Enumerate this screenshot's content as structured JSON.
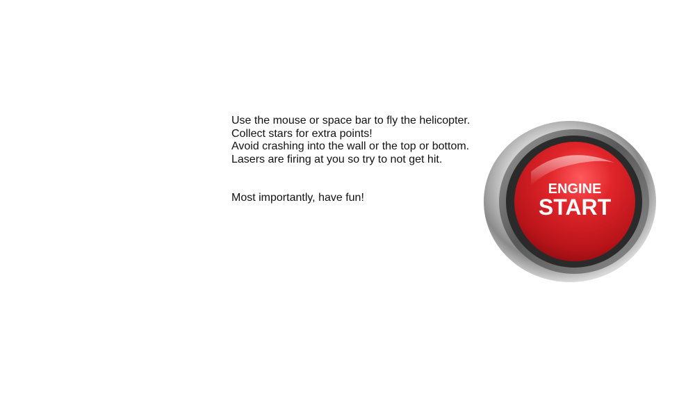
{
  "instructions": {
    "lines": [
      "Use the mouse or space bar to fly the helicopter.",
      "Collect stars for extra points!",
      "Avoid crashing into the wall or the top or bottom.",
      "Lasers are firing at you so try to not get hit."
    ],
    "closing": "Most importantly, have fun!"
  },
  "start_button": {
    "label_top": "ENGINE",
    "label_bottom": "START",
    "icon": "engine-start-button-icon",
    "button_color": "#d01c1f",
    "bezel_color": "#6e6e6e"
  }
}
